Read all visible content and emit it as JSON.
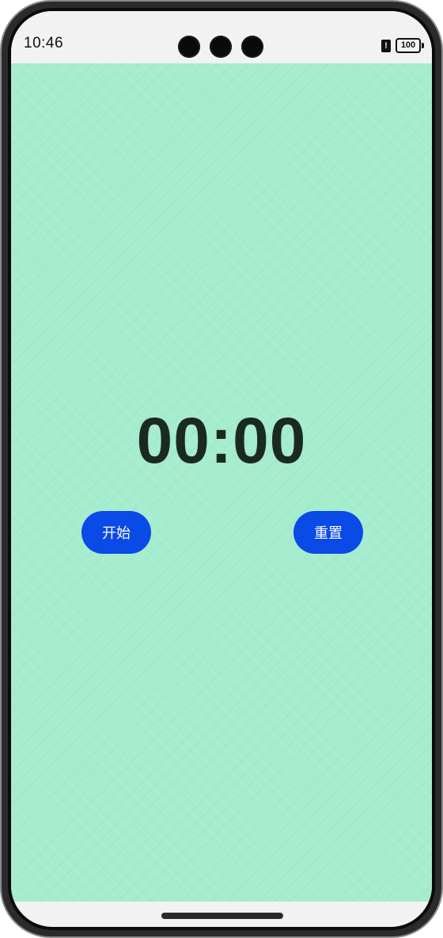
{
  "status_bar": {
    "time": "10:46",
    "alert_glyph": "!",
    "battery_level": "100"
  },
  "timer": {
    "display": "00:00"
  },
  "controls": {
    "start_label": "开始",
    "reset_label": "重置"
  },
  "colors": {
    "app_background": "#a6ecce",
    "button_background": "#0a4ae6",
    "timer_text": "#1b2a20"
  }
}
